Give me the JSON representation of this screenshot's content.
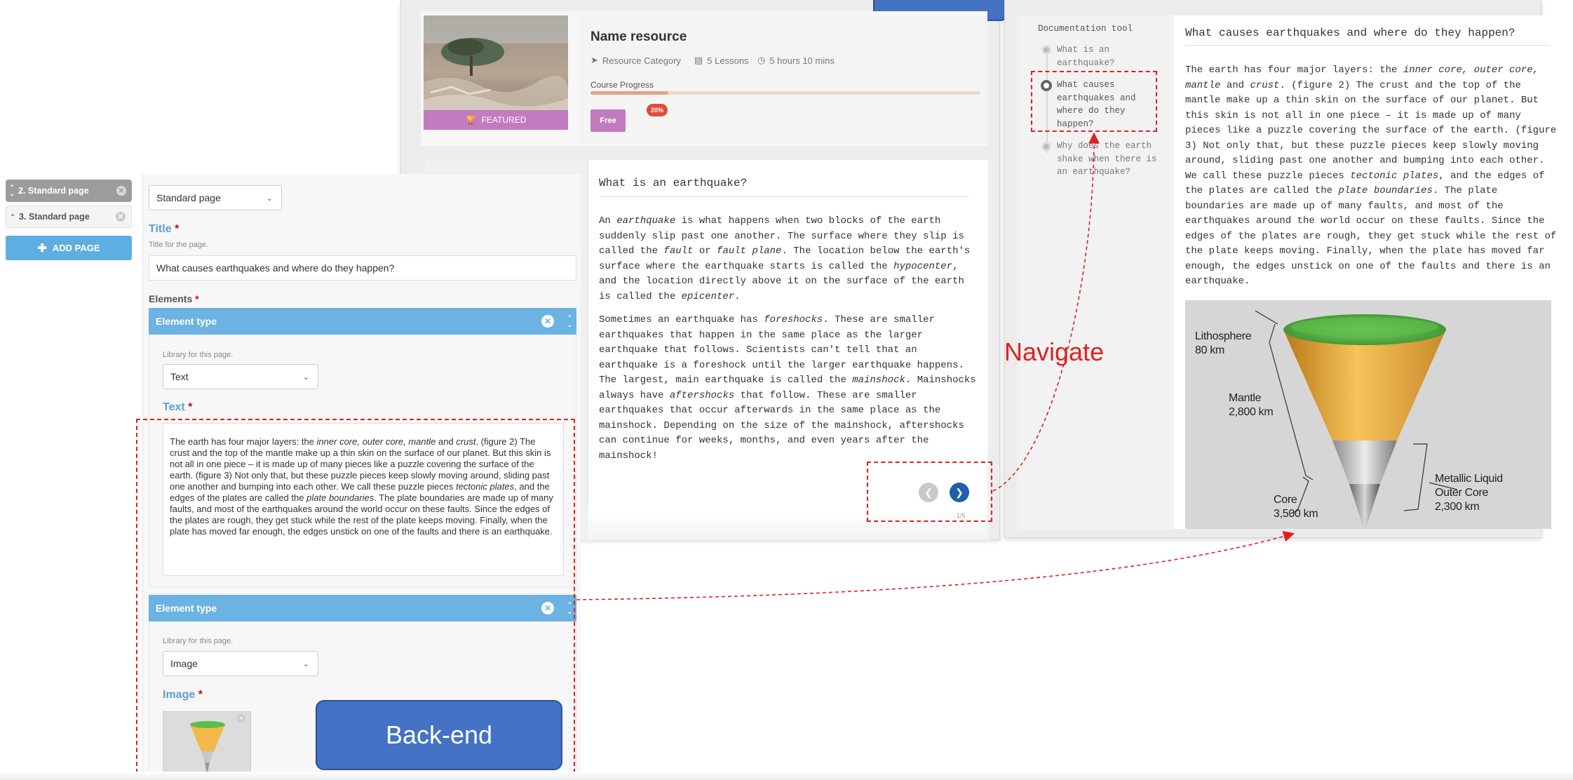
{
  "frontend": {
    "resource_name": "Name resource",
    "category": "Resource Category",
    "lessons": "5 Lessons",
    "duration": "5 hours 10 mins",
    "featured": "FEATURED",
    "progress_label": "Course Progress",
    "progress_value": 20,
    "progress_badge": "20%",
    "free_button": "Free",
    "lesson_title": "What is an earthquake?",
    "page_count": "1/5"
  },
  "documentation": {
    "tool_title": "Documentation tool",
    "toc": [
      {
        "label": "What is an earthquake?",
        "active": false
      },
      {
        "label": "What causes earthquakes and where do they happen?",
        "active": true
      },
      {
        "label": "Why does the earth shake when there is an earthquake?",
        "active": false
      }
    ],
    "page_title": "What causes earthquakes and where do they happen?",
    "figure_labels": {
      "lithosphere": "Lithosphere",
      "lithosphere_depth": "80 km",
      "mantle": "Mantle",
      "mantle_depth": "2,800 km",
      "core": "Core",
      "core_depth": "3,500 km",
      "outer_core_1": "Metallic Liquid",
      "outer_core_2": "Outer Core",
      "outer_core_depth": "2,300 km"
    }
  },
  "backend": {
    "page_tabs": [
      {
        "label": "2. Standard page"
      },
      {
        "label": "3. Standard page"
      }
    ],
    "add_page": "ADD PAGE",
    "page_library_value": "Standard page",
    "title_label": "Title",
    "required_mark": "*",
    "title_hint": "Title for the page.",
    "title_value": "What causes earthquakes and where do they happen?",
    "elements_label": "Elements",
    "element_type_label": "Element type",
    "library_hint": "Library for this page.",
    "element1_library": "Text",
    "text_label": "Text",
    "element2_library": "Image",
    "image_label": "Image"
  },
  "annotations": {
    "navigate": "Navigate",
    "backend": "Back-end"
  },
  "colors": {
    "accent_blue": "#6cb3e3",
    "featured_purple": "#c27bbf",
    "callout_blue": "#4472c4",
    "annotation_red": "#e02020",
    "nav_next": "#1f5fa8"
  }
}
